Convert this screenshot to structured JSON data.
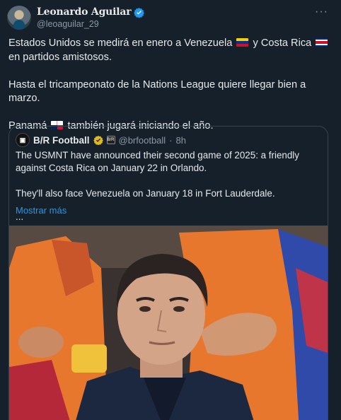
{
  "author": {
    "display_name": "Leonardo Aguilar",
    "handle": "@leoaguilar_29"
  },
  "tweet": {
    "line1_a": "Estados Unidos se medirá en enero a Venezuela",
    "line1_b": "y Costa Rica",
    "line1_c": "en partidos amistosos.",
    "line2": "Hasta el tricampeonato de la Nations League quiere llegar bien a marzo.",
    "line3_a": "Panamá",
    "line3_b": "también jugará iniciando el año."
  },
  "quoted": {
    "name": "B/R Football",
    "handle": "@brfootball",
    "separator": "·",
    "time": "8h",
    "paragraph1": "The USMNT have announced their second game of 2025: a friendly against Costa Rica on January 22 in Orlando.",
    "paragraph2": "They'll also face Venezuela on January 18 in Fort Lauderdale.",
    "ellipsis": "...",
    "show_more": "Mostrar más"
  },
  "icons": {
    "verified": "verified-badge-icon",
    "more": "more-options-icon",
    "flag_venezuela": "flag-venezuela-icon",
    "flag_costa_rica": "flag-costa-rica-icon",
    "flag_panama": "flag-panama-icon"
  },
  "colors": {
    "background": "#15202b",
    "accent": "#1d9bf0",
    "secondary_text": "#8b98a5",
    "verified_gold": "#e2b719"
  }
}
